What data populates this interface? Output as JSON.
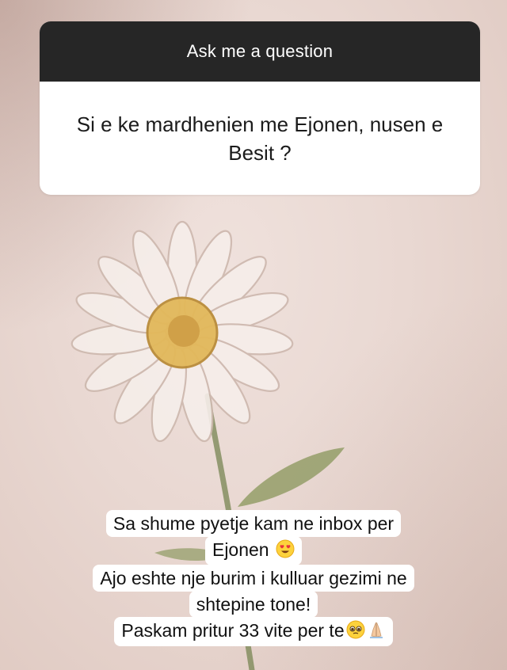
{
  "question_sticker": {
    "header": "Ask me a question",
    "question": "Si e ke mardhenien me Ejonen, nusen e Besit ?"
  },
  "caption": {
    "lines": [
      "Sa shume pyetje kam ne inbox per",
      "Ejonen",
      "Ajo eshte nje burim i kulluar gezimi ne",
      "shtepine tone!",
      "Paskam pritur 33 vite per te"
    ],
    "emojis": {
      "line2": "heart-eyes-emoji",
      "line5": [
        "pleading-face-emoji",
        "folded-hands-emoji"
      ]
    }
  },
  "colors": {
    "header_bg": "#262626",
    "card_bg": "#ffffff",
    "background": "#ebdcd6"
  }
}
